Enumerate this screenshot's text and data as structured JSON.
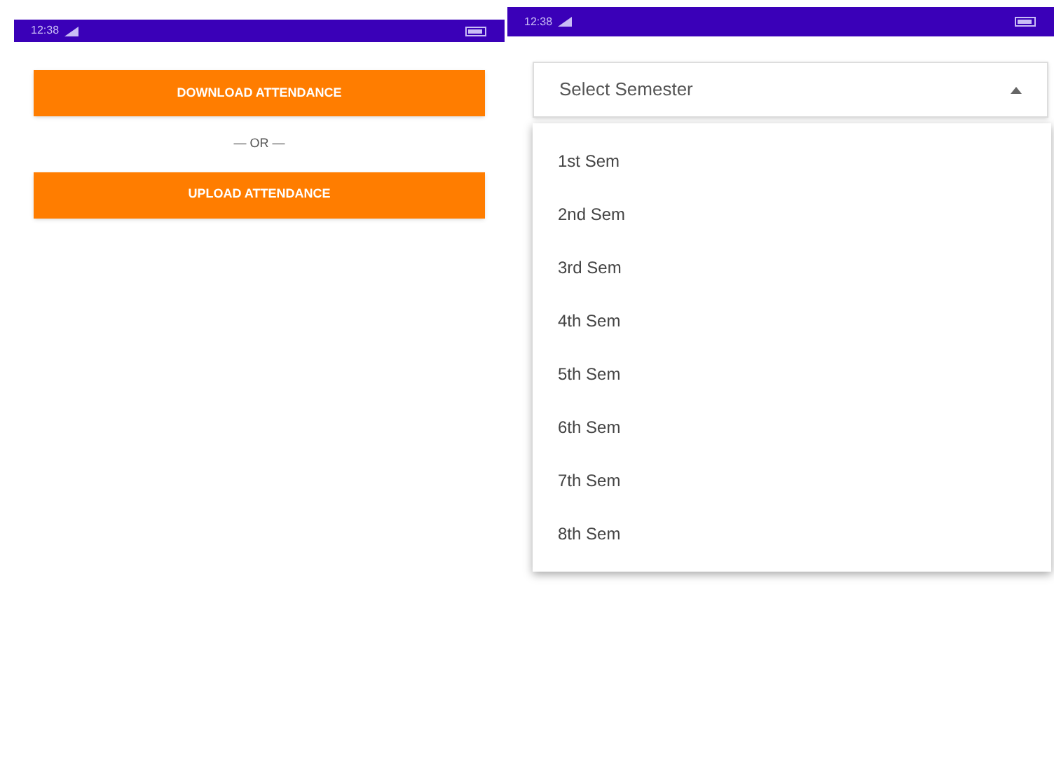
{
  "screens": [
    {
      "status_bar": {
        "time": "12:38"
      },
      "buttons": [
        "DOWNLOAD ATTENDANCE",
        "UPLOAD ATTENDANCE"
      ],
      "separator": "— OR —"
    },
    {
      "status_bar": {
        "time": "12:38"
      },
      "dropdown": {
        "placeholder": "Select Semester",
        "expanded": true,
        "options": [
          "1st Sem",
          "2nd Sem",
          "3rd Sem",
          "4th Sem",
          "5th Sem",
          "6th Sem",
          "7th Sem",
          "8th Sem"
        ]
      }
    }
  ]
}
